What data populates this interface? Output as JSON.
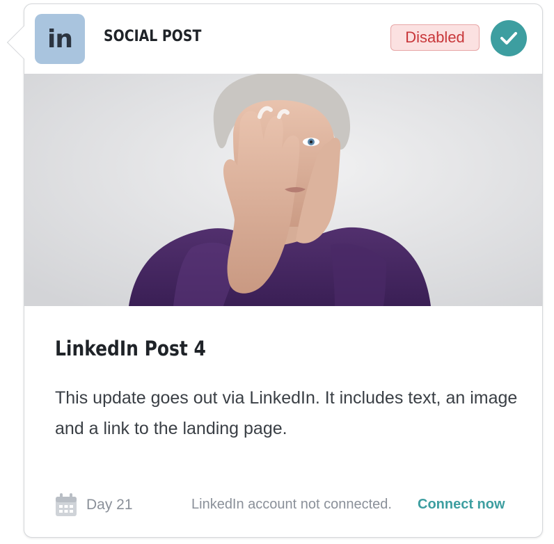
{
  "header": {
    "platform_icon_text": "in",
    "title": "SOCIAL POST",
    "status_badge": "Disabled",
    "check_icon": "check-icon"
  },
  "hero_image": {
    "icon": "portrait-photo"
  },
  "post": {
    "title": "LinkedIn Post 4",
    "description": "This update goes out via LinkedIn. It includes text, an image and a link to the landing page."
  },
  "footer": {
    "calendar_icon": "calendar-icon",
    "day": "Day 21",
    "account_status": "LinkedIn account not connected.",
    "connect_link": "Connect now"
  },
  "colors": {
    "accent": "#3d9ea0",
    "badge_bg": "#fbe1e1",
    "badge_text": "#c8373a",
    "platform_icon_bg": "#a9c4de"
  }
}
